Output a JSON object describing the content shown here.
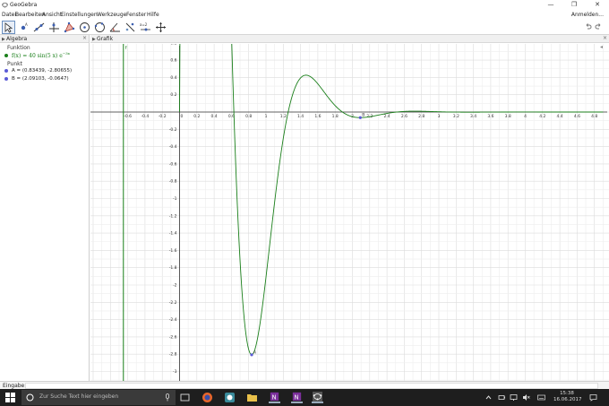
{
  "window": {
    "title": "GeoGebra",
    "login": "Anmelden..."
  },
  "menu": [
    "Datei",
    "Bearbeiten",
    "Ansicht",
    "Einstellungen",
    "Werkzeuge",
    "Fenster",
    "Hilfe"
  ],
  "algebra": {
    "title": "Algebra",
    "categories": {
      "function": "Funktion",
      "point": "Punkt"
    },
    "function_def": "f(x) = 40 sin(5 x) e",
    "function_exp": "−3x",
    "points": [
      {
        "text": "A = (0.83439, -2.80655)"
      },
      {
        "text": "B = (2.09103, -0.0647)"
      }
    ],
    "colors": {
      "function": "#1a7f1a",
      "point": "#5b5bd6"
    }
  },
  "graphics": {
    "title": "Grafik",
    "x_ticks": [
      "-0.6",
      "-0.4",
      "-0.2",
      "0",
      "0.2",
      "0.4",
      "0.6",
      "0.8",
      "1",
      "1.2",
      "1.4",
      "1.6",
      "1.8",
      "2",
      "2.2",
      "2.4",
      "2.6",
      "2.8",
      "3",
      "3.2",
      "3.4",
      "3.6",
      "3.8",
      "4",
      "4.2",
      "4.4",
      "4.6",
      "4.8"
    ],
    "y_ticks": [
      "0.8",
      "0.6",
      "0.4",
      "0.2",
      "-0.2",
      "-0.4",
      "-0.6",
      "-0.8",
      "-1",
      "-1.2",
      "-1.4",
      "-1.6",
      "-1.8",
      "-2",
      "-2.2",
      "-2.4",
      "-2.6",
      "-2.8",
      "-3"
    ],
    "vline_label": "f",
    "point_labels": [
      "A",
      "B"
    ]
  },
  "input": {
    "label": "Eingabe:"
  },
  "taskbar": {
    "search_placeholder": "Zur Suche Text hier eingeben",
    "time": "15:38",
    "date": "16.06.2017"
  }
}
